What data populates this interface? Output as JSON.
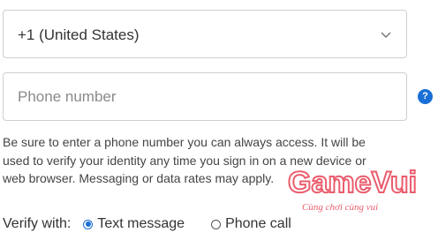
{
  "country_select": {
    "value": "+1 (United States)",
    "icon": "chevron-down-icon"
  },
  "phone": {
    "placeholder": "Phone number",
    "value": "",
    "help_icon": "question-icon",
    "help_glyph": "?"
  },
  "help_text": "Be sure to enter a phone number you can always access. It will be used to verify your identity any time you sign in on a new device or web browser. Messaging or data rates may apply.",
  "verify": {
    "label": "Verify with:",
    "options": [
      {
        "label": "Text message",
        "selected": true
      },
      {
        "label": "Phone call",
        "selected": false
      }
    ]
  },
  "watermark": {
    "brand": "GameVui",
    "tagline": "Cùng chơi cùng vui"
  },
  "colors": {
    "accent": "#1a6fd6",
    "border": "#cfcfcf",
    "watermark_red": "#e84c5e",
    "watermark_purple": "#9b59c9"
  }
}
